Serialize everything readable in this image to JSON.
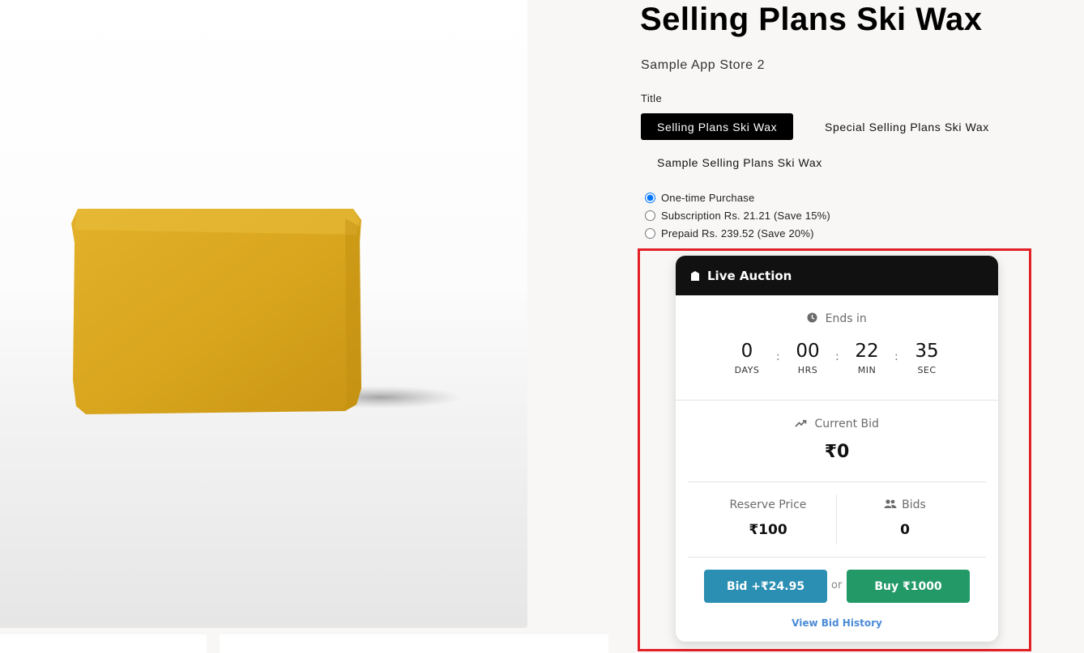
{
  "product": {
    "title": "Selling Plans Ski Wax",
    "vendor": "Sample App Store 2",
    "option_label": "Title",
    "variants": [
      {
        "label": "Selling Plans Ski Wax",
        "selected": true
      },
      {
        "label": "Special Selling Plans Ski Wax",
        "selected": false
      },
      {
        "label": "Sample Selling Plans Ski Wax",
        "selected": false
      }
    ],
    "selling_plans": [
      {
        "label": "One-time Purchase",
        "checked": true
      },
      {
        "label": "Subscription Rs. 21.21 (Save 15%)",
        "checked": false
      },
      {
        "label": "Prepaid Rs. 239.52 (Save 20%)",
        "checked": false
      }
    ]
  },
  "auction": {
    "header": "Live Auction",
    "ends_in_label": "Ends in",
    "countdown": [
      {
        "value": "0",
        "unit": "DAYS"
      },
      {
        "value": "00",
        "unit": "HRS"
      },
      {
        "value": "22",
        "unit": "MIN"
      },
      {
        "value": "35",
        "unit": "SEC"
      }
    ],
    "separator": ":",
    "current_bid_label": "Current Bid",
    "current_bid_value": "₹0",
    "reserve_label": "Reserve Price",
    "reserve_value": "₹100",
    "bids_label": "Bids",
    "bids_value": "0",
    "bid_button": "Bid +₹24.95",
    "or_text": "or",
    "buy_button": "Buy ₹1000",
    "history_link": "View Bid History"
  },
  "colors": {
    "highlight": "#e32026",
    "header_bg": "#111111",
    "bid_button": "#2a8fb2",
    "buy_button": "#239968",
    "link": "#4b8bd6",
    "wax": "#d9a520"
  },
  "icons": [
    "tag-icon",
    "clock-icon",
    "trend-up-icon",
    "users-icon"
  ]
}
